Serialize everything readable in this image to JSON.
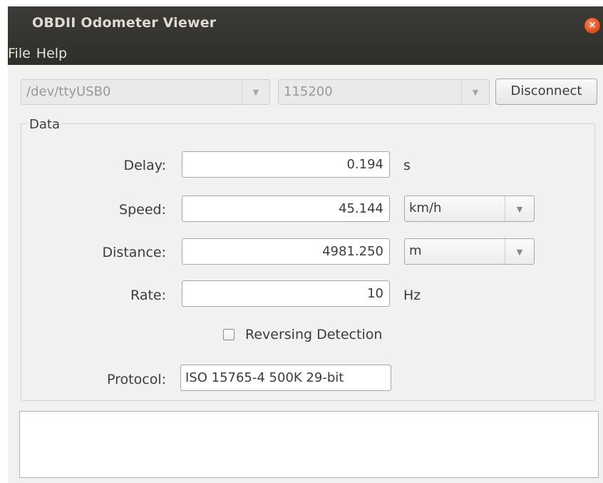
{
  "window": {
    "title": "OBDII Odometer Viewer",
    "close_glyph": "×"
  },
  "menu": {
    "items": [
      "File",
      "Help"
    ]
  },
  "connection": {
    "port": "/dev/ttyUSB0",
    "baud": "115200",
    "disconnect_label": "Disconnect",
    "dropdown_glyph": "▼"
  },
  "data_frame": {
    "title": "Data",
    "delay": {
      "label": "Delay:",
      "value": "0.194",
      "unit": "s"
    },
    "speed": {
      "label": "Speed:",
      "value": "45.144",
      "unit": "km/h"
    },
    "distance": {
      "label": "Distance:",
      "value": "4981.250",
      "unit": "m"
    },
    "rate": {
      "label": "Rate:",
      "value": "10",
      "unit": "Hz"
    },
    "reversing": {
      "label": "Reversing Detection",
      "checked": false
    },
    "protocol": {
      "label": "Protocol:",
      "value": "ISO 15765-4 500K 29-bit"
    }
  },
  "colors": {
    "titlebar": "#3c3b37",
    "close_button": "#df4a16",
    "window_bg": "#f2f1f0"
  }
}
